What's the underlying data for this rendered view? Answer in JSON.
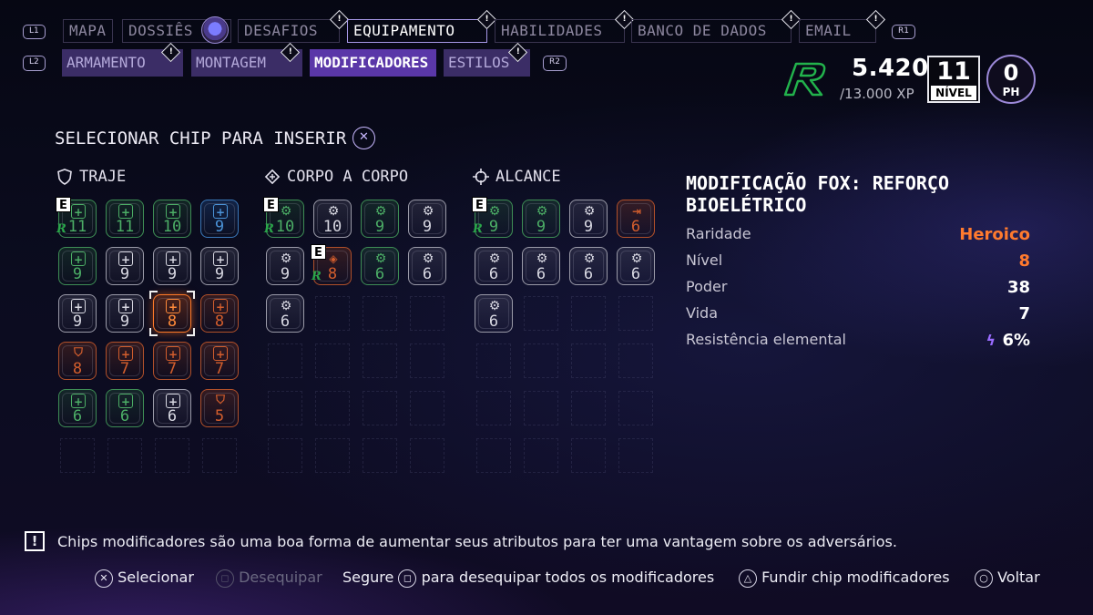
{
  "top_tabs": {
    "l1": "L1",
    "r1": "R1",
    "items": [
      {
        "label": "MAPA"
      },
      {
        "label": "DOSSIÊS"
      },
      {
        "label": "DESAFIOS"
      },
      {
        "label": "EQUIPAMENTO"
      },
      {
        "label": "HABILIDADES"
      },
      {
        "label": "BANCO DE DADOS"
      },
      {
        "label": "EMAIL"
      }
    ],
    "alert_glyph": "!"
  },
  "sub_tabs": {
    "l2": "L2",
    "r2": "R2",
    "items": [
      {
        "label": "ARMAMENTO"
      },
      {
        "label": "MONTAGEM"
      },
      {
        "label": "MODIFICADORES"
      },
      {
        "label": "ESTILOS"
      }
    ]
  },
  "player": {
    "xp": "5.420",
    "xp_total": "/13.000 XP",
    "level": "11",
    "level_label": "NÍVEL",
    "ph": "0",
    "ph_label": "PH",
    "emblem_icon": "robin-r-logo"
  },
  "heading": "SELECIONAR CHIP PARA INSERIR",
  "sections": {
    "traje": "TRAJE",
    "corpo": "CORPO A CORPO",
    "alcance": "ALCANCE"
  },
  "chips": {
    "traje": [
      {
        "v": "11",
        "c": "green",
        "i": "plus",
        "e": true,
        "r": true
      },
      {
        "v": "11",
        "c": "green",
        "i": "plus"
      },
      {
        "v": "10",
        "c": "green",
        "i": "plus"
      },
      {
        "v": "9",
        "c": "blue",
        "i": "plus"
      },
      {
        "v": "9",
        "c": "green",
        "i": "plus"
      },
      {
        "v": "9",
        "c": "grey",
        "i": "plus"
      },
      {
        "v": "9",
        "c": "grey",
        "i": "plus"
      },
      {
        "v": "9",
        "c": "grey",
        "i": "plus"
      },
      {
        "v": "9",
        "c": "grey",
        "i": "plus"
      },
      {
        "v": "9",
        "c": "grey",
        "i": "plus"
      },
      {
        "v": "8",
        "c": "sel",
        "i": "plus",
        "s": true
      },
      {
        "v": "8",
        "c": "orange",
        "i": "plus"
      },
      {
        "v": "8",
        "c": "orange",
        "i": "shield"
      },
      {
        "v": "7",
        "c": "orange",
        "i": "plus"
      },
      {
        "v": "7",
        "c": "orange",
        "i": "plus"
      },
      {
        "v": "7",
        "c": "orange",
        "i": "plus"
      },
      {
        "v": "6",
        "c": "green",
        "i": "plus"
      },
      {
        "v": "6",
        "c": "green",
        "i": "plus"
      },
      {
        "v": "6",
        "c": "grey",
        "i": "plus"
      },
      {
        "v": "5",
        "c": "orange",
        "i": "shield"
      }
    ],
    "corpo": [
      {
        "v": "10",
        "c": "green",
        "i": "gear",
        "e": true,
        "r": true
      },
      {
        "v": "10",
        "c": "grey",
        "i": "gear"
      },
      {
        "v": "9",
        "c": "green",
        "i": "gear"
      },
      {
        "v": "9",
        "c": "grey",
        "i": "gear"
      },
      {
        "v": "9",
        "c": "grey",
        "i": "gear"
      },
      {
        "v": "8",
        "c": "orange",
        "i": "diamond",
        "e": true,
        "r": true
      },
      {
        "v": "6",
        "c": "green",
        "i": "gear"
      },
      {
        "v": "6",
        "c": "grey",
        "i": "gear"
      },
      {
        "v": "6",
        "c": "grey",
        "i": "gear"
      }
    ],
    "alcance": [
      {
        "v": "9",
        "c": "green",
        "i": "gear",
        "e": true,
        "r": true
      },
      {
        "v": "9",
        "c": "green",
        "i": "gear"
      },
      {
        "v": "9",
        "c": "grey",
        "i": "gear"
      },
      {
        "v": "6",
        "c": "orange",
        "i": "door"
      },
      {
        "v": "6",
        "c": "grey",
        "i": "gear"
      },
      {
        "v": "6",
        "c": "grey",
        "i": "gear"
      },
      {
        "v": "6",
        "c": "grey",
        "i": "gear"
      },
      {
        "v": "6",
        "c": "grey",
        "i": "gear"
      },
      {
        "v": "6",
        "c": "grey",
        "i": "gear"
      }
    ]
  },
  "badges": {
    "equipped": "E"
  },
  "details": {
    "title": "MODIFICAÇÃO FOX: REFORÇO BIOELÉTRICO",
    "stats": [
      {
        "label": "Raridade",
        "value": "Heroico"
      },
      {
        "label": "Nível",
        "value": "8"
      },
      {
        "label": "Poder",
        "value": "38"
      },
      {
        "label": "Vida",
        "value": "7"
      },
      {
        "label": "Resistência elemental",
        "value": "6%"
      }
    ],
    "rarity_color": "#ff7a2e"
  },
  "tip": "Chips modificadores são uma boa forma de aumentar seus atributos para ter uma vantagem sobre os adversários.",
  "actions": {
    "select": "Selecionar",
    "unequip": "Desequipar",
    "hold": "Segure",
    "unequip_all": "para desequipar todos os modificadores",
    "merge": "Fundir chip modificadores",
    "back": "Voltar"
  }
}
